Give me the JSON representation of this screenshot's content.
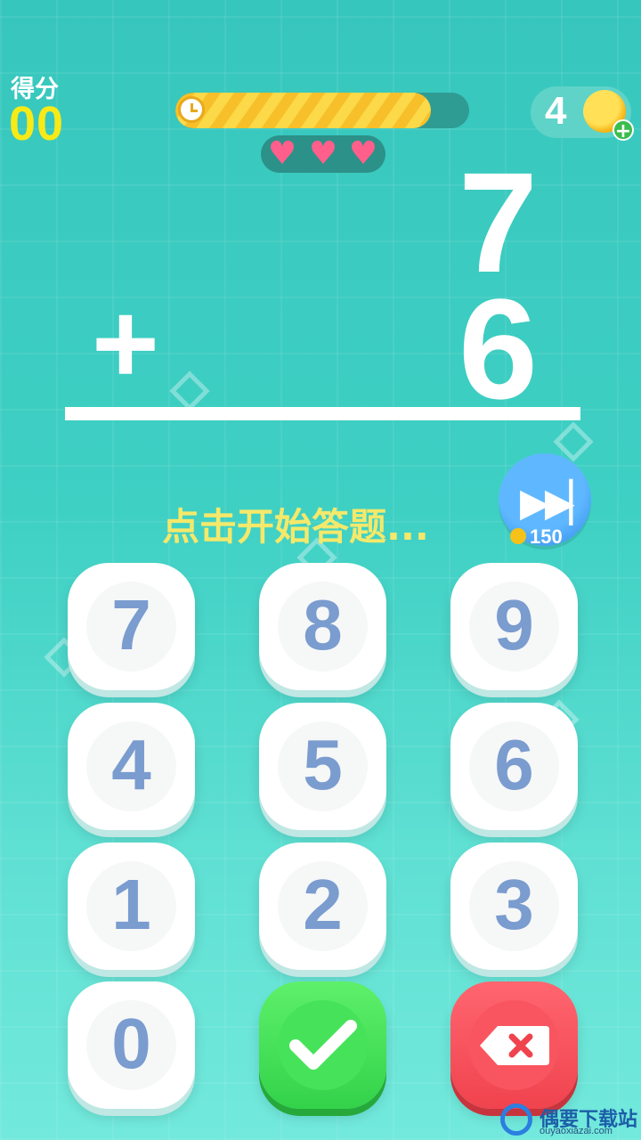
{
  "score": {
    "label": "得分",
    "value": "00"
  },
  "timer": {
    "progress": 0.87
  },
  "lives": {
    "count": 3,
    "icon": "heart-icon",
    "color": "#ff5f8a"
  },
  "coins": {
    "count": "4",
    "icon": "coin-icon",
    "add_icon": "plus-icon"
  },
  "problem": {
    "top_number": "7",
    "operator": "+",
    "bottom_number": "6"
  },
  "hint": {
    "text": "点击开始答题..."
  },
  "skip": {
    "icon": "fast-forward-icon",
    "cost": "150"
  },
  "keypad": {
    "keys": [
      "7",
      "8",
      "9",
      "4",
      "5",
      "6",
      "1",
      "2",
      "3",
      "0"
    ],
    "confirm_icon": "check-icon",
    "delete_icon": "backspace-icon"
  },
  "watermark": {
    "title": "偶要下载站",
    "url": "ouyaoxiazai.com"
  },
  "colors": {
    "score": "#f7ea17",
    "confirm": "#33d24a",
    "delete": "#f0434e",
    "skip": "#2f86e6",
    "digit": "#7a9ccf"
  }
}
